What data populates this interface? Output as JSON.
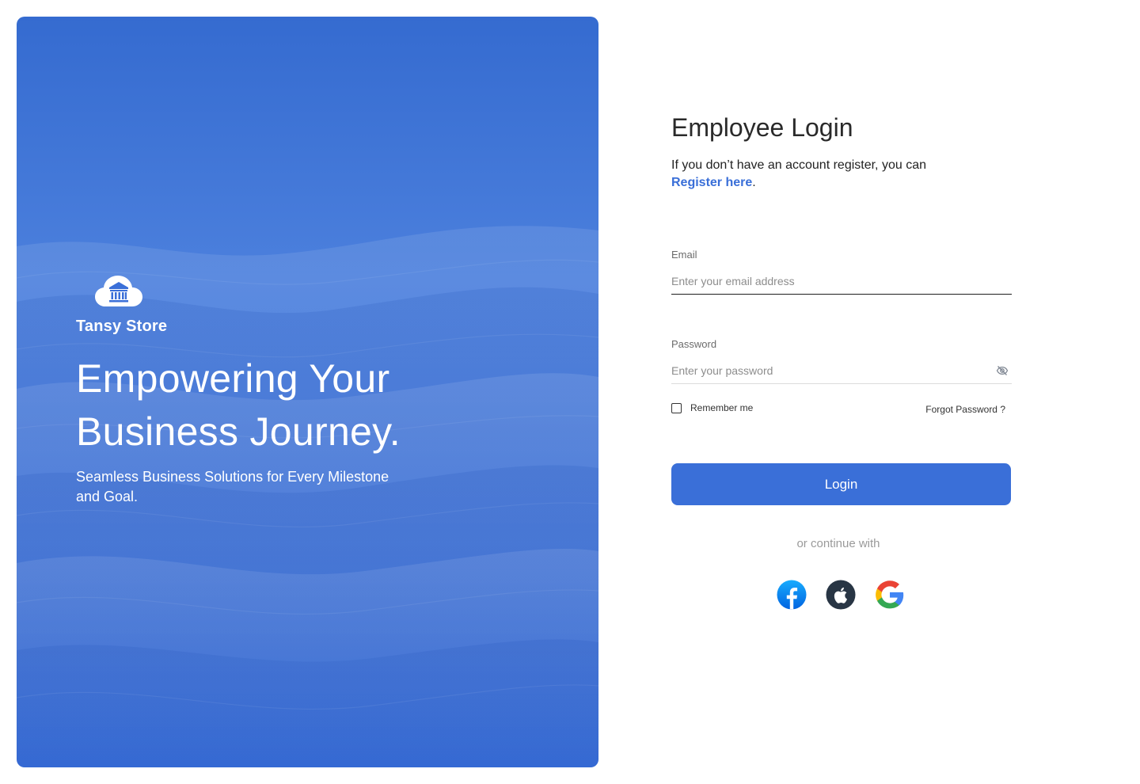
{
  "brand": {
    "name": "Tansy Store",
    "logo_icon": "bank-cloud-icon"
  },
  "hero": {
    "title_line1": "Empowering Your",
    "title_line2": "Business Journey.",
    "subtitle": "Seamless Business Solutions for Every Milestone and Goal."
  },
  "login": {
    "title": "Employee Login",
    "intro": "If you don’t have an account register, you can",
    "register_link": "Register here",
    "register_suffix": ".",
    "email": {
      "label": "Email",
      "placeholder": "Enter your email address",
      "value": ""
    },
    "password": {
      "label": "Password",
      "placeholder": "Enter your password",
      "value": "",
      "toggle_icon": "eye-off-icon"
    },
    "remember_label": "Remember me",
    "remember_checked": false,
    "forgot_label": "Forgot Password ?",
    "login_button": "Login",
    "continue_text": "or continue with",
    "social": [
      {
        "name": "facebook",
        "icon": "facebook-icon",
        "color": "#1877f2"
      },
      {
        "name": "apple",
        "icon": "apple-icon",
        "color": "#283544"
      },
      {
        "name": "google",
        "icon": "google-icon",
        "color": "#4285f4"
      }
    ]
  },
  "colors": {
    "accent": "#3a6fd8",
    "hero_blue": "#3f74d6",
    "text_dark": "#2a2a2a"
  }
}
